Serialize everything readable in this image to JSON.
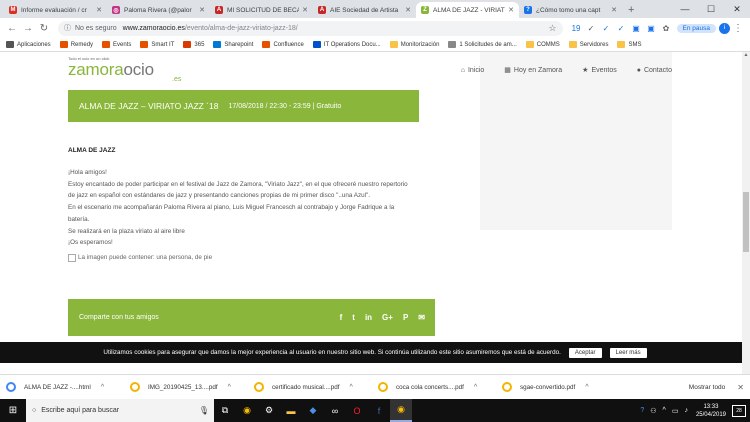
{
  "tabs": [
    {
      "title": "Informe evaluación / cr",
      "icon": "gmail-icon",
      "color": "#d93025",
      "glyph": "M",
      "active": false
    },
    {
      "title": "Paloma Rivera (@palor",
      "icon": "instagram-icon",
      "color": "#c13584",
      "glyph": "◎",
      "active": false
    },
    {
      "title": "MI SOLICITUD DE BECA",
      "icon": "aie-icon",
      "color": "#c62828",
      "glyph": "A",
      "active": false
    },
    {
      "title": "AIE Sociedad de Artista",
      "icon": "aie-icon",
      "color": "#c62828",
      "glyph": "A",
      "active": false
    },
    {
      "title": "ALMA DE JAZZ - VIRIAT",
      "icon": "zamora-icon",
      "color": "#8ab63b",
      "glyph": "Z",
      "active": true
    },
    {
      "title": "¿Cómo tomo una capt",
      "icon": "help-icon",
      "color": "#1a73e8",
      "glyph": "?",
      "active": false
    }
  ],
  "window": {
    "minimize": "—",
    "maximize": "☐",
    "close": "✕",
    "new_tab": "+"
  },
  "toolbar": {
    "back": "←",
    "forward": "→",
    "reload": "↻",
    "not_secure": "No es seguro",
    "url_host": "www.zamoraocio.es",
    "url_path": "/evento/alma-de-jazz-viriato-jazz-18/",
    "pausa": "En pausa",
    "avatar": "i",
    "menu": "⋮"
  },
  "bookmarks": [
    {
      "label": "Aplicaciones",
      "icon": "apps-icon",
      "color": "#555"
    },
    {
      "label": "Remedy",
      "icon": "remedy-icon",
      "color": "#e65100"
    },
    {
      "label": "Events",
      "icon": "events-icon",
      "color": "#e65100"
    },
    {
      "label": "Smart IT",
      "icon": "smartit-icon",
      "color": "#e65100"
    },
    {
      "label": "365",
      "icon": "office-icon",
      "color": "#d83b01"
    },
    {
      "label": "Sharepoint",
      "icon": "sharepoint-icon",
      "color": "#0078d4"
    },
    {
      "label": "Confluence",
      "icon": "confluence-icon",
      "color": "#e65100"
    },
    {
      "label": "IT Operations Docu...",
      "icon": "it-ops-icon",
      "color": "#0052cc"
    },
    {
      "label": "Monitorización",
      "icon": "folder-icon",
      "color": "#f9c349"
    },
    {
      "label": "1 Solicitudes de am...",
      "icon": "page-icon",
      "color": "#888"
    },
    {
      "label": "COMMS",
      "icon": "folder-icon",
      "color": "#f9c349"
    },
    {
      "label": "Servidores",
      "icon": "folder-icon",
      "color": "#f9c349"
    },
    {
      "label": "SMS",
      "icon": "folder-icon",
      "color": "#f9c349"
    }
  ],
  "site": {
    "tagline": "Todo el ocio en un click",
    "logo_text": "zamora",
    "logo_suffix": "ocio",
    "logo_domain": ".es",
    "nav": [
      {
        "label": "Inicio",
        "icon": "home-icon",
        "glyph": "⌂"
      },
      {
        "label": "Hoy en Zamora",
        "icon": "calendar-icon",
        "glyph": "▦"
      },
      {
        "label": "Eventos",
        "icon": "star-icon",
        "glyph": "★"
      },
      {
        "label": "Contacto",
        "icon": "chat-icon",
        "glyph": "●"
      }
    ],
    "event_title": "ALMA DE JAZZ – VIRIATO JAZZ ´18",
    "event_meta": "17/08/2018 / 22:30 - 23:59 | Gratuito",
    "heading": "ALMA DE JAZZ",
    "paragraphs": [
      "¡Hola amigos!",
      "Estoy encantado de poder participar en el festival de Jazz de Zamora, \"Viriato Jazz\", en el que ofreceré nuestro repertorio",
      "de jazz en español con estándares de jazz y presentando canciones propias de mi primer disco \"..una Azul\".",
      "En el escenario me acompañarán Paloma Rivera al piano, Luis Miguel Francesch al contrabajo y Jorge Fadrique a la",
      "batería.",
      "Se realizará en la plaza viriato al aire libre",
      "¡Os esperamos!"
    ],
    "image_alt": "La imagen puede contener: una persona, de pie",
    "share_label": "Comparte con tus amigos",
    "share_icons": [
      {
        "icon": "facebook-icon",
        "glyph": "f"
      },
      {
        "icon": "twitter-icon",
        "glyph": "t"
      },
      {
        "icon": "linkedin-icon",
        "glyph": "in"
      },
      {
        "icon": "googleplus-icon",
        "glyph": "G+"
      },
      {
        "icon": "pinterest-icon",
        "glyph": "P"
      },
      {
        "icon": "email-icon",
        "glyph": "✉"
      }
    ],
    "accent": "#8ab63b"
  },
  "cookie": {
    "text": "Utilizamos cookies para asegurar que damos la mejor experiencia al usuario en nuestro sitio web. Si continúa utilizando este sitio asumiremos que está de acuerdo.",
    "accept": "Aceptar",
    "more": "Leer más"
  },
  "downloads": [
    {
      "name": "ALMA DE JAZZ -....html",
      "type": "html"
    },
    {
      "name": "IMG_20190425_13....pdf",
      "type": "pdf"
    },
    {
      "name": "certificado musical....pdf",
      "type": "pdf"
    },
    {
      "name": "coca cola concerts....pdf",
      "type": "pdf"
    },
    {
      "name": "sgae-convertido.pdf",
      "type": "pdf"
    }
  ],
  "downloads_show_all": "Mostrar todo",
  "taskbar": {
    "search_placeholder": "Escribe aquí para buscar",
    "time": "13:33",
    "date": "25/04/2019",
    "notif_count": "28"
  }
}
